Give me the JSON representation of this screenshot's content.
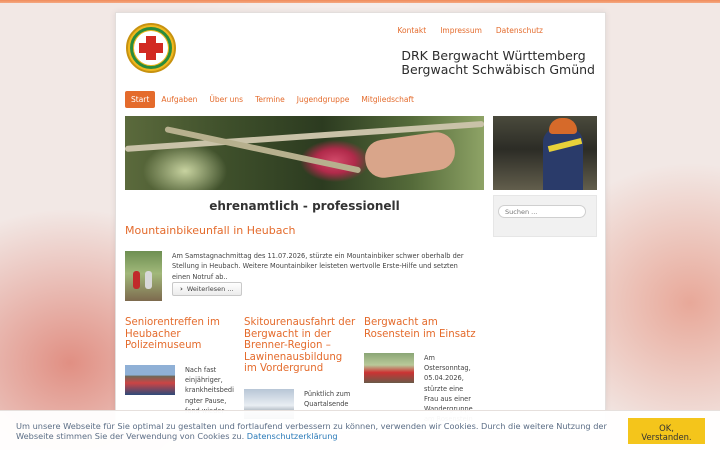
{
  "site": {
    "title_line1": "DRK Bergwacht Württemberg",
    "title_line2": "Bergwacht Schwäbisch Gmünd"
  },
  "topnav": [
    {
      "label": "Kontakt"
    },
    {
      "label": "Impressum"
    },
    {
      "label": "Datenschutz"
    }
  ],
  "mainnav": [
    {
      "label": "Start",
      "active": true
    },
    {
      "label": "Aufgaben"
    },
    {
      "label": "Über uns"
    },
    {
      "label": "Termine"
    },
    {
      "label": "Jugendgruppe"
    },
    {
      "label": "Mitgliedschaft"
    }
  ],
  "tagline": "ehrenamtlich - professionell",
  "search": {
    "placeholder": "Suchen ..."
  },
  "featured": {
    "title": "Mountainbikeunfall in Heubach",
    "text": "Am Samstagnachmittag des 11.07.2026, stürzte ein Mountainbiker schwer oberhalb der Stellung in Heubach. Weitere Mountainbiker leisteten wertvolle Erste-Hilfe und setzten einen Notruf ab..",
    "button": "Weiterlesen ...",
    "button_icon": "chevron-right-icon"
  },
  "columns": [
    {
      "title": "Seniorentreffen im Heubacher Polizeimuseum",
      "snippet": "Nach fast einjähriger, krankheitsbedi ngter Pause, fand wieder"
    },
    {
      "title": "Skitourenausfahrt der Bergwacht in der Brenner-Region – Lawinenausbildung im Vordergrund",
      "snippet": "Pünktlich zum Quartalsende"
    },
    {
      "title": "Bergwacht am Rosenstein im Einsatz",
      "snippet": "Am Ostersonntag, 05.04.2026, stürzte eine Frau aus einer Wandergruppe am Rosenstein"
    }
  ],
  "cookie": {
    "text": "Um unsere Webseite für Sie optimal zu gestalten und fortlaufend verbessern zu können, verwenden wir Cookies. Durch die weitere Nutzung der Webseite stimmen Sie der Verwendung von Cookies zu.",
    "link": "Datenschutzerklärung",
    "button_line1": "OK,",
    "button_line2": "Verstanden."
  },
  "colors": {
    "accent": "#e46b2c",
    "cookie_button": "#f4c51b",
    "link_blue": "#2a7ab8"
  }
}
